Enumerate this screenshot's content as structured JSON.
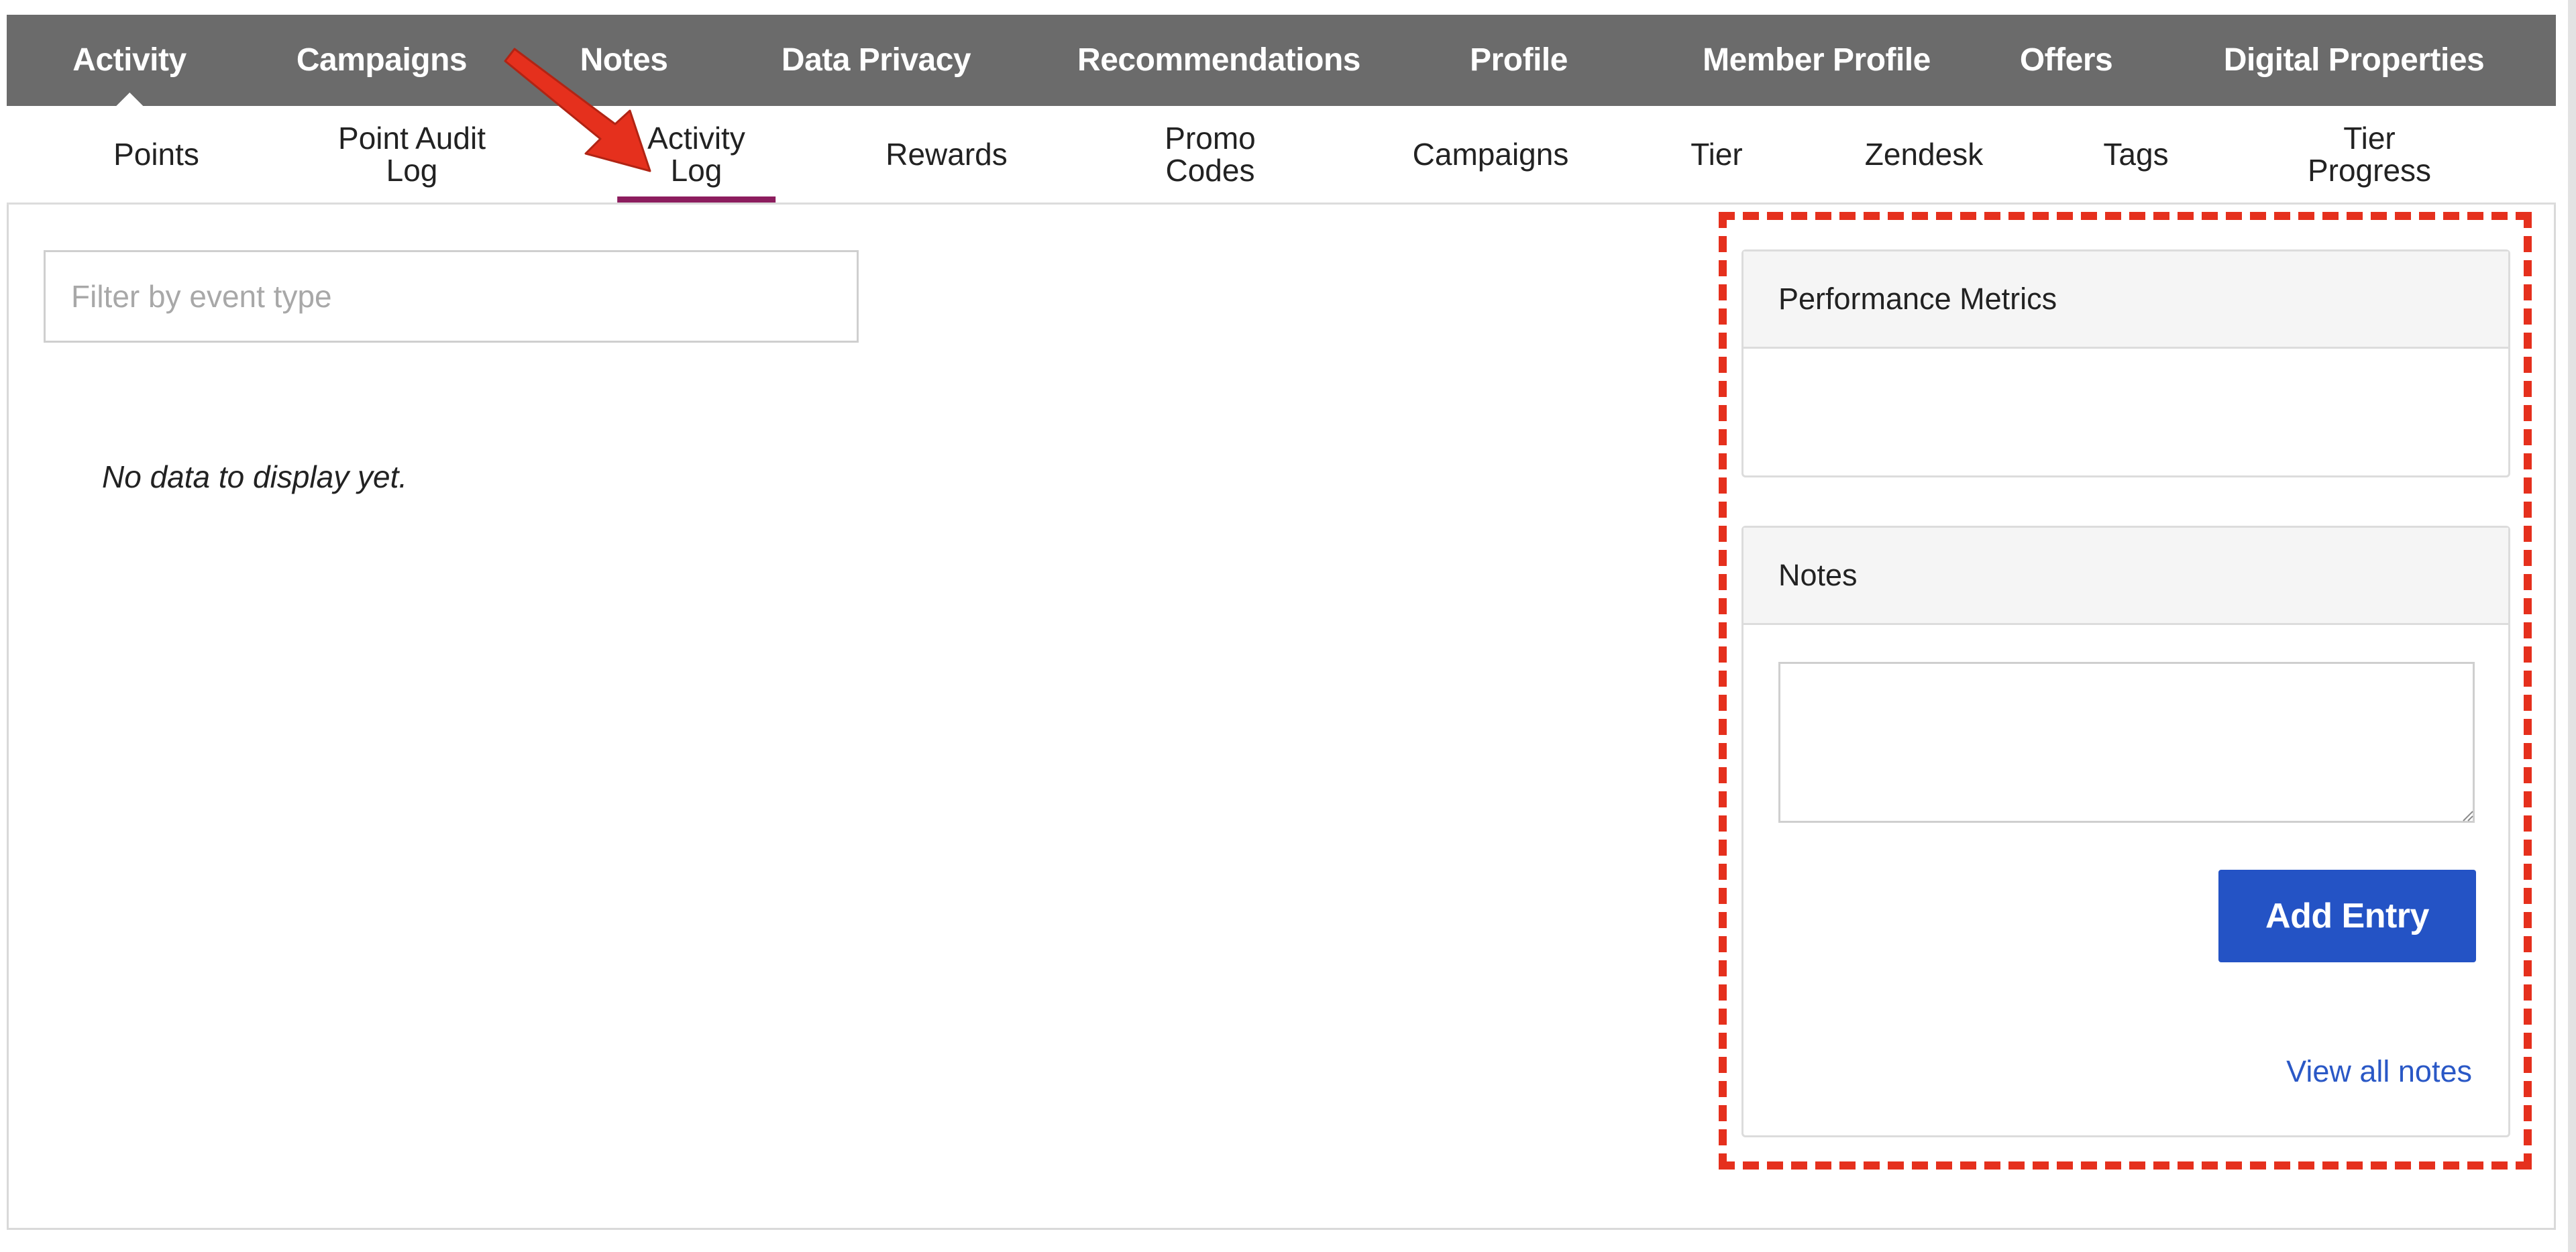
{
  "top_nav": {
    "items": [
      "Activity",
      "Campaigns",
      "Notes",
      "Data Privacy",
      "Recommendations",
      "Profile",
      "Member Profile",
      "Offers",
      "Digital Properties"
    ],
    "active": "Activity"
  },
  "sub_nav": {
    "items": [
      {
        "line1": "Points",
        "line2": ""
      },
      {
        "line1": "Point Audit",
        "line2": "Log"
      },
      {
        "line1": "Activity",
        "line2": "Log"
      },
      {
        "line1": "Rewards",
        "line2": ""
      },
      {
        "line1": "Promo",
        "line2": "Codes"
      },
      {
        "line1": "Campaigns",
        "line2": ""
      },
      {
        "line1": "Tier",
        "line2": ""
      },
      {
        "line1": "Zendesk",
        "line2": ""
      },
      {
        "line1": "Tags",
        "line2": ""
      },
      {
        "line1": "Tier",
        "line2": "Progress"
      }
    ],
    "active": "Activity Log"
  },
  "filter": {
    "placeholder": "Filter by event type",
    "value": ""
  },
  "empty_message": "No data to display yet.",
  "performance_panel": {
    "title": "Performance Metrics"
  },
  "notes_panel": {
    "title": "Notes",
    "textarea_value": "",
    "add_button_label": "Add Entry",
    "view_all_label": "View all notes"
  },
  "colors": {
    "top_nav_bg": "#6b6b6b",
    "active_underline": "#8c1d5e",
    "primary_button": "#2453c5",
    "link": "#2a58c6",
    "annotation_red": "#e5301d"
  },
  "icons": {
    "annotation": "arrow-annotation-icon",
    "resize": "resize-grip-icon"
  }
}
